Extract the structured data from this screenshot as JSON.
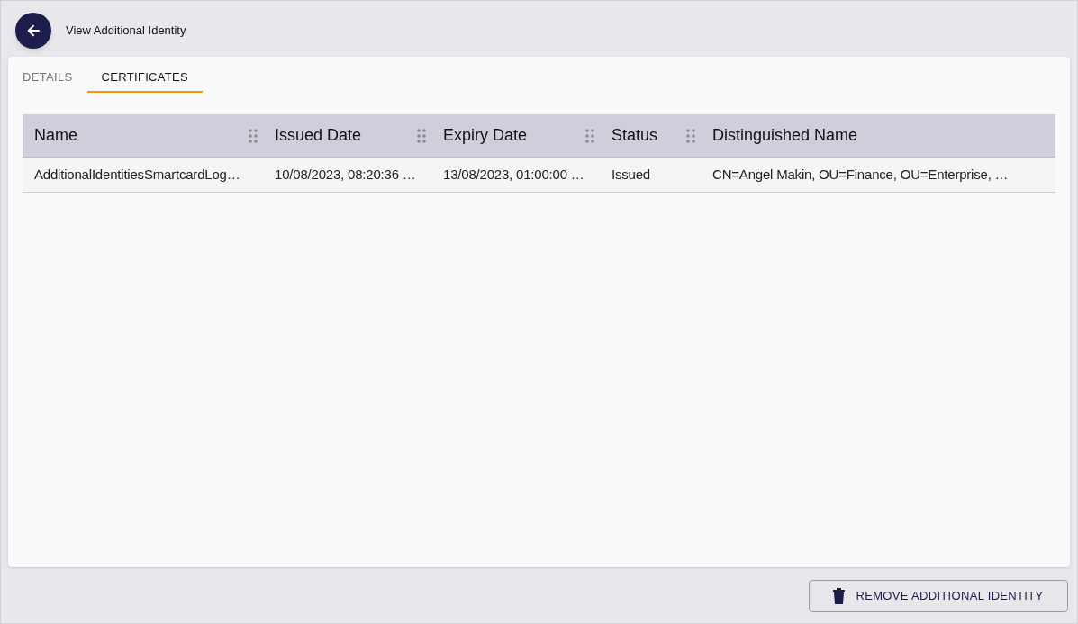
{
  "header": {
    "title": "View Additional Identity"
  },
  "tabs": [
    {
      "label": "DETAILS",
      "selected": false
    },
    {
      "label": "CERTIFICATES",
      "selected": true
    }
  ],
  "table": {
    "columns": [
      "Name",
      "Issued Date",
      "Expiry Date",
      "Status",
      "Distinguished Name"
    ],
    "rows": [
      [
        "AdditionalIdentitiesSmartcardLog…",
        "10/08/2023, 08:20:36 …",
        "13/08/2023, 01:00:00 …",
        "Issued",
        "CN=Angel Makin, OU=Finance, OU=Enterprise, …"
      ]
    ]
  },
  "footer": {
    "button": "REMOVE ADDITIONAL IDENTITY"
  }
}
